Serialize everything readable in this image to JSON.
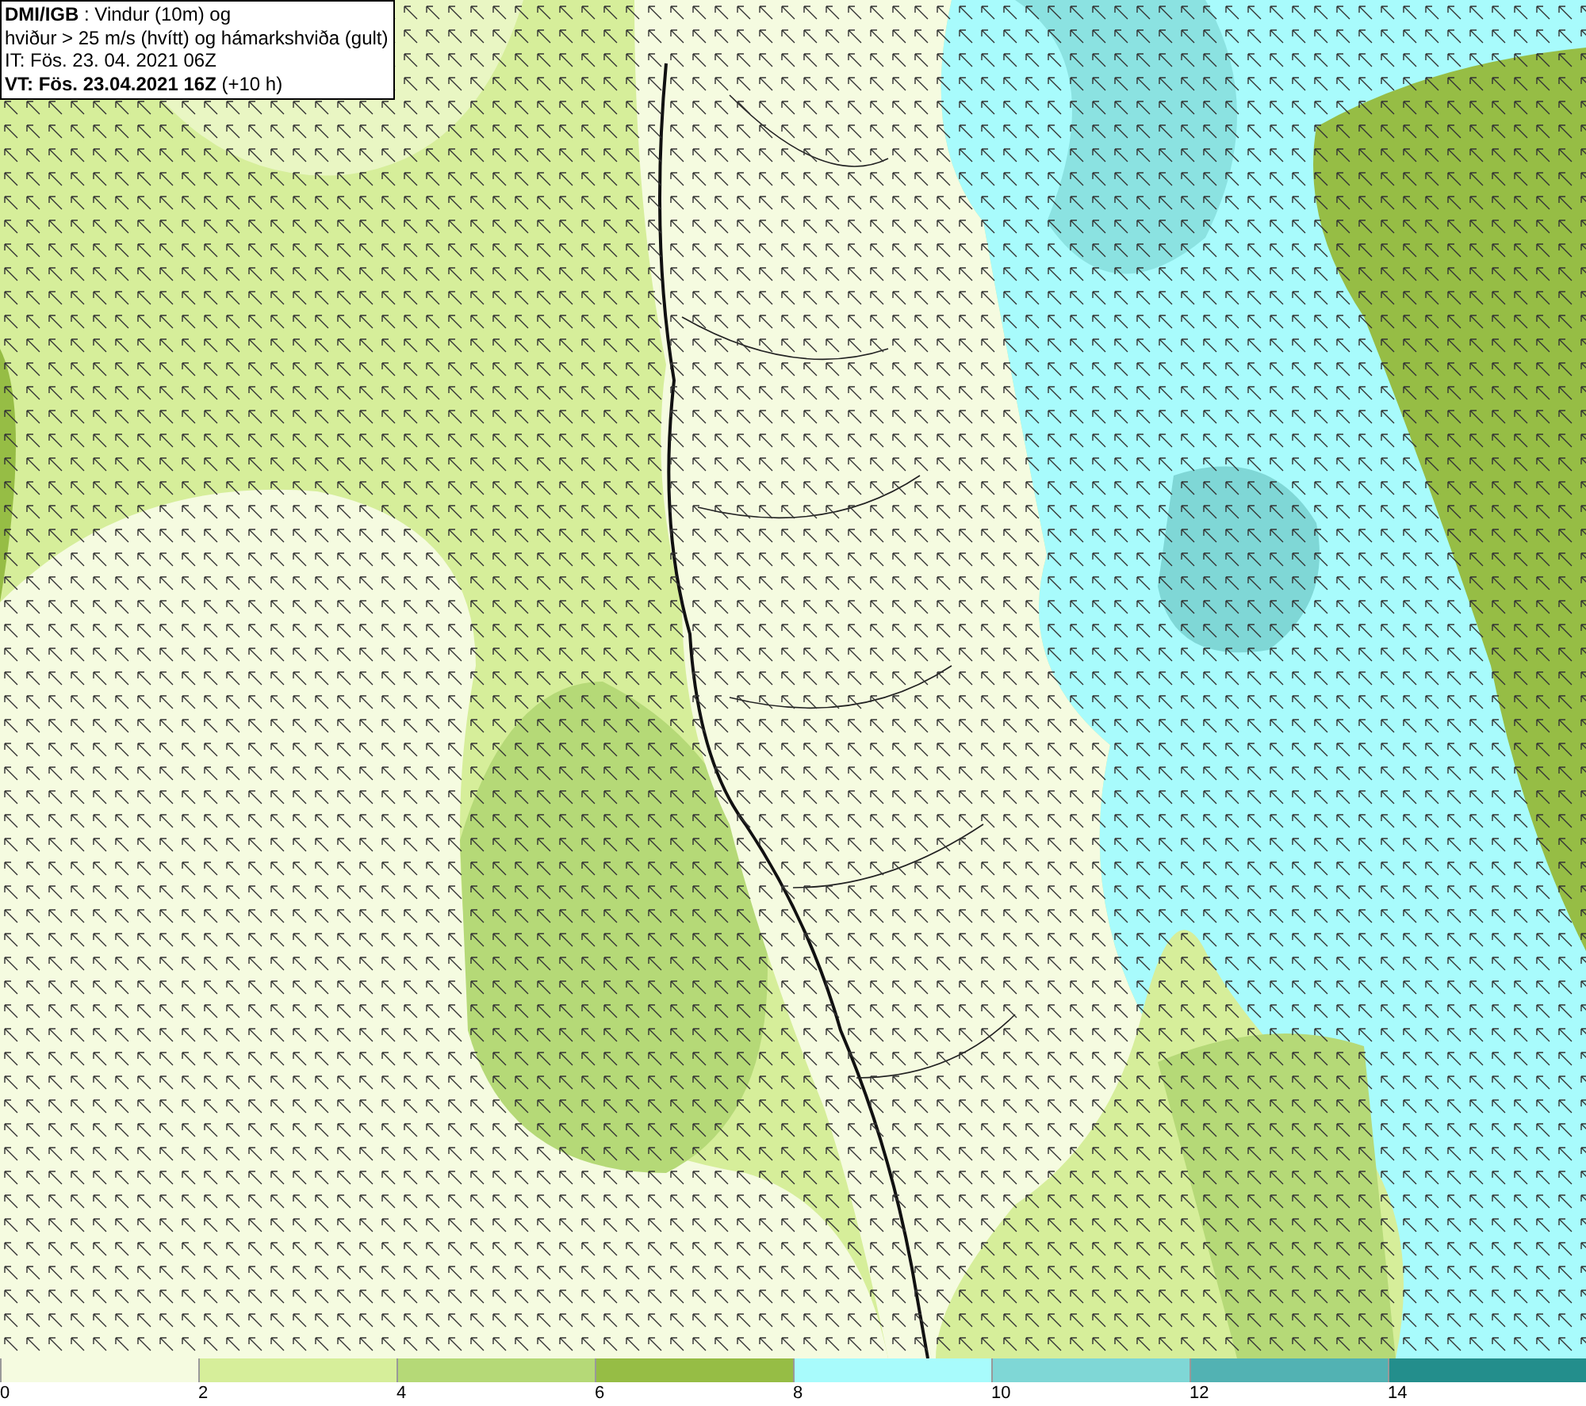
{
  "title_box": {
    "lines": [
      "**DMI/IGB** : Vindur (10m) og",
      "hviður > 25 m/s (hvítt) og hámarkshviða (gult)",
      "IT: Fös. 23. 04. 2021 06Z",
      "**VT: Fös. 23.04.2021 16Z** (+10 h)"
    ]
  },
  "legend": {
    "swatches": [
      {
        "color": "#f5fbe0"
      },
      {
        "color": "#d6ee9a"
      },
      {
        "color": "#b5d977"
      },
      {
        "color": "#96bd45"
      },
      {
        "color": "#a8fbfc"
      },
      {
        "color": "#7fd7d6"
      },
      {
        "color": "#52b2b3"
      },
      {
        "color": "#238e8c"
      }
    ],
    "labels": [
      "0",
      "2",
      "4",
      "6",
      "8",
      "10",
      "12",
      "14"
    ]
  }
}
